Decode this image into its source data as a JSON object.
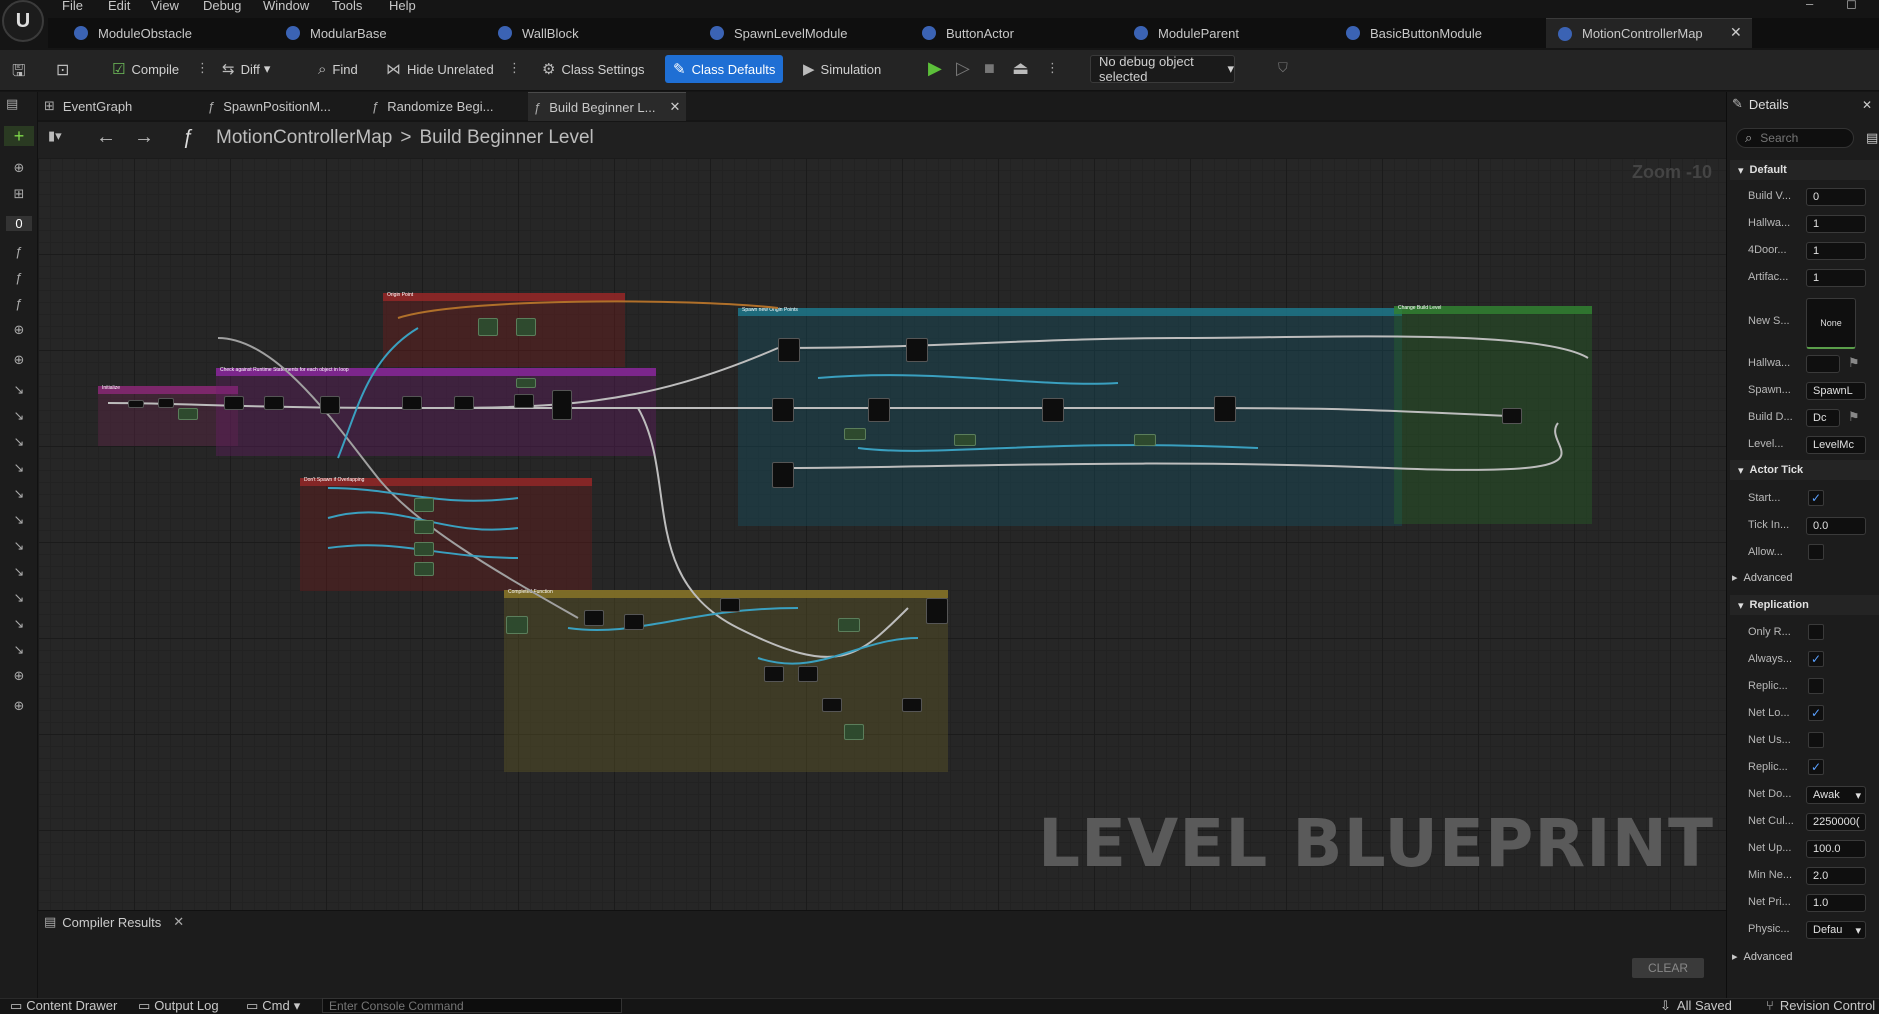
{
  "menu": [
    "File",
    "Edit",
    "View",
    "Debug",
    "Window",
    "Tools",
    "Help"
  ],
  "tabs": [
    {
      "label": "ModuleObstacle"
    },
    {
      "label": "ModularBase"
    },
    {
      "label": "WallBlock"
    },
    {
      "label": "SpawnLevelModule"
    },
    {
      "label": "ButtonActor"
    },
    {
      "label": "ModuleParent"
    },
    {
      "label": "BasicButtonModule"
    },
    {
      "label": "MotionControllerMap",
      "active": true
    }
  ],
  "toolbar": {
    "compile": "Compile",
    "diff": "Diff",
    "find": "Find",
    "hide_unrelated": "Hide Unrelated",
    "class_settings": "Class Settings",
    "class_defaults": "Class Defaults",
    "simulation": "Simulation",
    "debug_object": "No debug object selected"
  },
  "graph_tabs": [
    "EventGraph",
    "SpawnPositionM...",
    "Randomize Begi...",
    "Build Beginner L..."
  ],
  "breadcrumb": {
    "root": "MotionControllerMap",
    "separator": ">",
    "current": "Build Beginner Level"
  },
  "graph": {
    "zoom": "Zoom -10",
    "watermark": "LEVEL BLUEPRINT"
  },
  "compiler": {
    "tab": "Compiler Results",
    "clear": "CLEAR"
  },
  "status": {
    "content_drawer": "Content Drawer",
    "output_log": "Output Log",
    "cmd": "Cmd",
    "console_placeholder": "Enter Console Command",
    "saved": "All Saved",
    "revision": "Revision Control"
  },
  "details": {
    "title": "Details",
    "search_placeholder": "Search",
    "sections": {
      "default": "Default",
      "actor_tick": "Actor Tick",
      "advanced": "Advanced",
      "replication": "Replication",
      "advanced2": "Advanced"
    },
    "rows": {
      "build_v": {
        "label": "Build V...",
        "value": "0"
      },
      "hallwa": {
        "label": "Hallwa...",
        "value": "1"
      },
      "door4": {
        "label": "4Door...",
        "value": "1"
      },
      "artifac": {
        "label": "Artifac...",
        "value": "1"
      },
      "new_s": {
        "label": "New S...",
        "value": "None"
      },
      "hallwa2": {
        "label": "Hallwa...",
        "value": ""
      },
      "spawn": {
        "label": "Spawn...",
        "value": "SpawnL"
      },
      "build_d": {
        "label": "Build D...",
        "value": "Dc"
      },
      "level": {
        "label": "Level...",
        "value": "LevelMc"
      },
      "start": {
        "label": "Start...",
        "checked": true
      },
      "tick_in": {
        "label": "Tick In...",
        "value": "0.0"
      },
      "allow": {
        "label": "Allow...",
        "checked": false
      },
      "only_r": {
        "label": "Only R...",
        "checked": false
      },
      "always": {
        "label": "Always...",
        "checked": true
      },
      "replic": {
        "label": "Replic...",
        "checked": false
      },
      "net_lo": {
        "label": "Net Lo...",
        "checked": true
      },
      "net_us": {
        "label": "Net Us...",
        "checked": false
      },
      "replic2": {
        "label": "Replic...",
        "checked": true
      },
      "net_do": {
        "label": "Net Do...",
        "value": "Awak"
      },
      "net_cul": {
        "label": "Net Cul...",
        "value": "2250000("
      },
      "net_up": {
        "label": "Net Up...",
        "value": "100.0"
      },
      "min_ne": {
        "label": "Min Ne...",
        "value": "2.0"
      },
      "net_pri": {
        "label": "Net Pri...",
        "value": "1.0"
      },
      "physic": {
        "label": "Physic...",
        "value": "Defau"
      }
    }
  },
  "comment_titles": {
    "origin": "Origin Point",
    "spawn": "Spawn new Origin Points",
    "change": "Change Build Level",
    "initialize": "Initialize",
    "check": "Check against Runtime Statements for each object in loop",
    "spawner": "Don't Spawn if Overlapping",
    "complete": "Completed Function"
  },
  "colors": {
    "accent": "#1f6fd4",
    "check": "#5aa0ff"
  }
}
